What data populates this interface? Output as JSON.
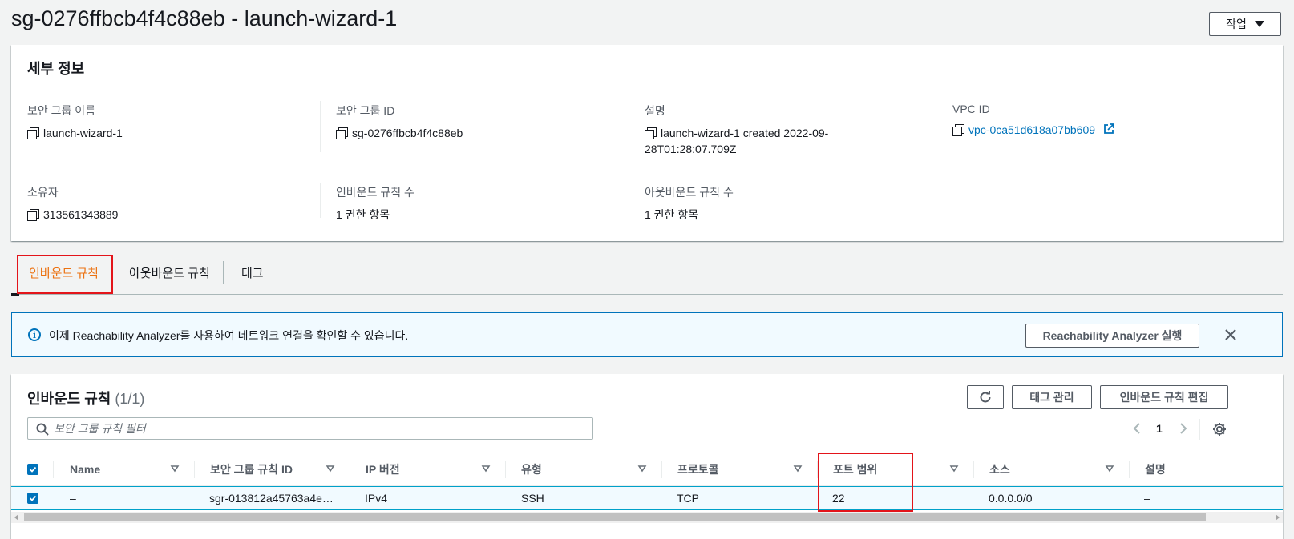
{
  "page": {
    "title": "sg-0276ffbcb4f4c88eb - launch-wizard-1",
    "actions_label": "작업"
  },
  "details": {
    "header": "세부 정보",
    "sg_name": {
      "label": "보안 그룹 이름",
      "value": "launch-wizard-1"
    },
    "sg_id": {
      "label": "보안 그룹 ID",
      "value": "sg-0276ffbcb4f4c88eb"
    },
    "description": {
      "label": "설명",
      "value_line1": "launch-wizard-1 created 2022-09-",
      "value_line2": "28T01:28:07.709Z"
    },
    "vpc_id": {
      "label": "VPC ID",
      "value": "vpc-0ca51d618a07bb609"
    },
    "owner": {
      "label": "소유자",
      "value": "313561343889"
    },
    "inbound_count": {
      "label": "인바운드 규칙 수",
      "value": "1 권한 항목"
    },
    "outbound_count": {
      "label": "아웃바운드 규칙 수",
      "value": "1 권한 항목"
    }
  },
  "tabs": [
    {
      "label": "인바운드 규칙",
      "active": true
    },
    {
      "label": "아웃바운드 규칙",
      "active": false
    },
    {
      "label": "태그",
      "active": false
    }
  ],
  "alert": {
    "text": "이제 Reachability Analyzer를 사용하여 네트워크 연결을 확인할 수 있습니다.",
    "button": "Reachability Analyzer 실행"
  },
  "inbound": {
    "title": "인바운드 규칙",
    "count": "(1/1)",
    "manage_tags": "태그 관리",
    "edit_rules": "인바운드 규칙 편집",
    "search_placeholder": "보안 그룹 규칙 필터",
    "page": "1",
    "columns": [
      "Name",
      "보안 그룹 규칙 ID",
      "IP 버전",
      "유형",
      "프로토콜",
      "포트 범위",
      "소스",
      "설명"
    ],
    "rows": [
      {
        "name": "–",
        "rule_id": "sgr-013812a45763a4e…",
        "ip_version": "IPv4",
        "type": "SSH",
        "protocol": "TCP",
        "port_range": "22",
        "source": "0.0.0.0/0",
        "description": "–"
      }
    ]
  },
  "colors": {
    "accent": "#ec7211",
    "link": "#0073bb",
    "highlight": "#e3141a"
  },
  "icons": [
    "copy-icon",
    "external-link-icon",
    "info-icon",
    "close-icon",
    "refresh-icon",
    "search-icon",
    "chevron-left-icon",
    "chevron-right-icon",
    "gear-icon",
    "sort-icon",
    "caret-down-icon"
  ]
}
